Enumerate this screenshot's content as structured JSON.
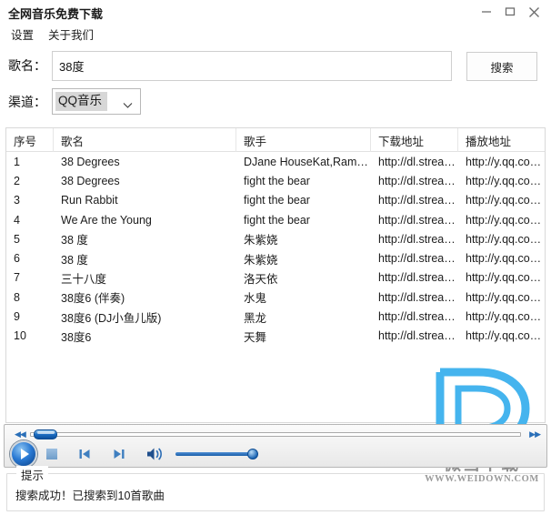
{
  "window": {
    "title": "全网音乐免费下载",
    "controls": {
      "minimize": "minimize-icon",
      "maximize": "maximize-icon",
      "close": "close-icon"
    }
  },
  "menu": {
    "items": [
      {
        "label": "设置"
      },
      {
        "label": "关于我们"
      }
    ]
  },
  "search": {
    "song_label": "歌名：",
    "song_value": "38度",
    "song_placeholder": "",
    "channel_label": "渠道：",
    "channel_value": "QQ音乐",
    "channel_options": [
      "QQ音乐"
    ],
    "search_button": "搜索"
  },
  "table": {
    "columns": [
      "序号",
      "歌名",
      "歌手",
      "下载地址",
      "播放地址"
    ],
    "rows": [
      {
        "index": "1",
        "song": "38 Degrees",
        "artist": "DJane HouseKat,Ram…",
        "download": "http://dl.strea…",
        "play": "http://y.qq.co…"
      },
      {
        "index": "2",
        "song": "38 Degrees",
        "artist": "fight the bear",
        "download": "http://dl.strea…",
        "play": "http://y.qq.co…"
      },
      {
        "index": "3",
        "song": "Run Rabbit",
        "artist": "fight the bear",
        "download": "http://dl.strea…",
        "play": "http://y.qq.co…"
      },
      {
        "index": "4",
        "song": "We Are the Young",
        "artist": "fight the bear",
        "download": "http://dl.strea…",
        "play": "http://y.qq.co…"
      },
      {
        "index": "5",
        "song": "38 度",
        "artist": "朱紫娆",
        "download": "http://dl.strea…",
        "play": "http://y.qq.co…"
      },
      {
        "index": "6",
        "song": "38 度",
        "artist": "朱紫娆",
        "download": "http://dl.strea…",
        "play": "http://y.qq.co…"
      },
      {
        "index": "7",
        "song": "三十八度",
        "artist": "洛天依",
        "download": "http://dl.strea…",
        "play": "http://y.qq.co…"
      },
      {
        "index": "8",
        "song": "38度6 (伴奏)",
        "artist": "水鬼",
        "download": "http://dl.strea…",
        "play": "http://y.qq.co…"
      },
      {
        "index": "9",
        "song": "38度6 (DJ小鱼儿版)",
        "artist": "黑龙",
        "download": "http://dl.strea…",
        "play": "http://y.qq.co…"
      },
      {
        "index": "10",
        "song": "38度6",
        "artist": "天舞",
        "download": "http://dl.strea…",
        "play": "http://y.qq.co…"
      }
    ]
  },
  "watermark": {
    "brand": "微当下载",
    "site": "WWW.WEIDOWN.COM",
    "logo": "letter-d-logo"
  },
  "player": {
    "play": "play-icon",
    "stop": "stop-icon",
    "previous": "previous-track-icon",
    "next": "next-track-icon",
    "volume": "volume-icon",
    "rewind": "rewind-icon",
    "fast_forward": "fast-forward-icon",
    "seek_position_percent": 1,
    "volume_percent": 100
  },
  "tip": {
    "legend": "提示",
    "message": "搜索成功！已搜索到10首歌曲"
  },
  "colors": {
    "accent": "#1d6fc4",
    "watermark_blue": "#45b4ee",
    "text": "#1a1a1a"
  }
}
